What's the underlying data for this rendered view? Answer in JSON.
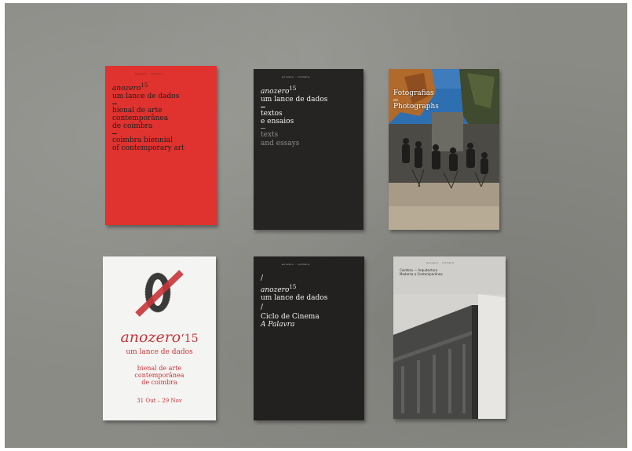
{
  "booklets": [
    {
      "tag": "anozero · coimbra",
      "brand": "anozero",
      "year": "15",
      "subtitle": "um lance de dados",
      "lines_pt": [
        "bienal de arte",
        "contemporânea",
        "de coimbra"
      ],
      "lines_en": [
        "coimbra biennial",
        "of contemporary art"
      ],
      "colors": {
        "cover": "#e0322e",
        "text": "#1f1f1f"
      }
    },
    {
      "tag": "anozero · coimbra",
      "brand": "anozero",
      "year": "15",
      "subtitle": "um lance de dados",
      "lines_pt": [
        "textos",
        "e ensaios"
      ],
      "lines_en": [
        "texts",
        "and essays"
      ],
      "colors": {
        "cover": "#262422",
        "text": "#f2f2f2",
        "muted": "#8f8d8a"
      }
    },
    {
      "title_pt": "Fotografias",
      "title_en": "Photographs",
      "colors": {
        "sky": "#2e6fb1",
        "foliage": "#b16a2b"
      }
    },
    {
      "brand": "anozero",
      "year": "‘15",
      "subtitle": "um lance de dados",
      "lines": [
        "bienal de arte",
        "contemporânea",
        "de coimbra"
      ],
      "dates": "31 Out – 29 Nov",
      "colors": {
        "cover": "#f4f4f2",
        "accent": "#c9353a",
        "logo": "#3a3a38"
      }
    },
    {
      "tag": "anozero · coimbra",
      "slash": "/",
      "brand": "anozero",
      "year": "15",
      "subtitle": "um lance de dados",
      "title": "Ciclo de Cinema",
      "title_italic": "A Palavra",
      "colors": {
        "cover": "#232120",
        "text": "#f2f2f2"
      }
    },
    {
      "tag": "anozero · coimbra",
      "lines": [
        "Coimbra — Arquitectura",
        "Moderna e Contemporânea"
      ],
      "colors": {
        "cover": "#cfceca"
      }
    }
  ],
  "colors": {
    "surface": "#8b8b86"
  }
}
